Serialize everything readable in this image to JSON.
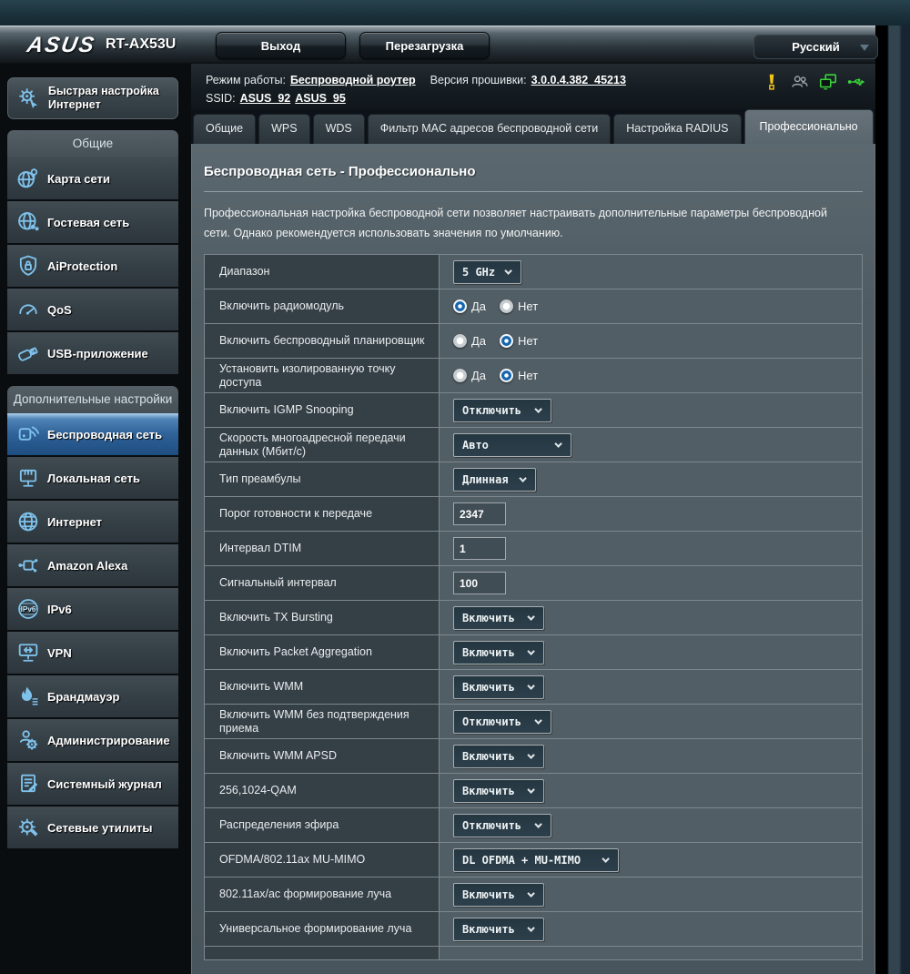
{
  "header": {
    "brand": "ASUS",
    "model": "RT-AX53U",
    "logout_label": "Выход",
    "reboot_label": "Перезагрузка",
    "language": "Русский"
  },
  "infobar": {
    "mode_label": "Режим работы:",
    "mode_value": "Беспроводной роутер",
    "firmware_label": "Версия прошивки:",
    "firmware_value": "3.0.0.4.382_45213",
    "ssid_label": "SSID:",
    "ssids": [
      "ASUS_92",
      "ASUS_95"
    ],
    "status_icons": [
      "warning-icon",
      "clients-icon",
      "devices-icon",
      "usb-icon"
    ]
  },
  "tabs": [
    {
      "label": "Общие",
      "active": false
    },
    {
      "label": "WPS",
      "active": false
    },
    {
      "label": "WDS",
      "active": false
    },
    {
      "label": "Фильтр MAC адресов беспроводной сети",
      "active": false
    },
    {
      "label": "Настройка RADIUS",
      "active": false
    },
    {
      "label": "Профессионально",
      "active": true
    }
  ],
  "page": {
    "title": "Беспроводная сеть - Профессионально",
    "description": "Профессиональная настройка беспроводной сети позволяет настраивать дополнительные параметры беспроводной сети. Однако рекомендуется использовать значения по умолчанию."
  },
  "sidebar": {
    "quick_setup": "Быстрая настройка Интернет",
    "quick_setup_icon": "quick-setup-icon",
    "groups": [
      {
        "header": "Общие",
        "items": [
          {
            "id": "network-map",
            "label": "Карта сети",
            "icon": "network-map-icon",
            "active": false
          },
          {
            "id": "guest-network",
            "label": "Гостевая сеть",
            "icon": "guest-network-icon",
            "active": false
          },
          {
            "id": "aiprotection",
            "label": "AiProtection",
            "icon": "aiprotection-icon",
            "active": false
          },
          {
            "id": "qos",
            "label": "QoS",
            "icon": "qos-icon",
            "active": false
          },
          {
            "id": "usb-app",
            "label": "USB-приложение",
            "icon": "usb-app-icon",
            "active": false
          }
        ]
      },
      {
        "header": "Дополнительные настройки",
        "items": [
          {
            "id": "wireless",
            "label": "Беспроводная сеть",
            "icon": "wireless-icon",
            "active": true
          },
          {
            "id": "lan",
            "label": "Локальная сеть",
            "icon": "lan-icon",
            "active": false
          },
          {
            "id": "wan",
            "label": "Интернет",
            "icon": "internet-icon",
            "active": false
          },
          {
            "id": "alexa",
            "label": "Amazon Alexa",
            "icon": "alexa-icon",
            "active": false
          },
          {
            "id": "ipv6",
            "label": "IPv6",
            "icon": "ipv6-icon",
            "active": false
          },
          {
            "id": "vpn",
            "label": "VPN",
            "icon": "vpn-icon",
            "active": false
          },
          {
            "id": "firewall",
            "label": "Брандмауэр",
            "icon": "firewall-icon",
            "active": false
          },
          {
            "id": "administration",
            "label": "Администрирование",
            "icon": "administration-icon",
            "active": false
          },
          {
            "id": "syslog",
            "label": "Системный журнал",
            "icon": "syslog-icon",
            "active": false
          },
          {
            "id": "network-tools",
            "label": "Сетевые утилиты",
            "icon": "network-tools-icon",
            "active": false
          }
        ]
      }
    ]
  },
  "form": {
    "rows": [
      {
        "label": "Диапазон",
        "type": "select",
        "value": "5 GHz"
      },
      {
        "label": "Включить радиомодуль",
        "type": "radio",
        "options": [
          "Да",
          "Нет"
        ],
        "selected": "Да"
      },
      {
        "label": "Включить беспроводный планировщик",
        "type": "radio",
        "options": [
          "Да",
          "Нет"
        ],
        "selected": "Нет"
      },
      {
        "label": "Установить изолированную точку доступа",
        "type": "radio",
        "options": [
          "Да",
          "Нет"
        ],
        "selected": "Нет"
      },
      {
        "label": "Включить IGMP Snooping",
        "type": "select",
        "value": "Отключить"
      },
      {
        "label": "Скорость многоадресной передачи данных (Мбит/с)",
        "type": "select",
        "value": "Авто",
        "wide": true
      },
      {
        "label": "Тип преамбулы",
        "type": "select",
        "value": "Длинная"
      },
      {
        "label": "Порог готовности к передаче",
        "type": "input",
        "value": "2347"
      },
      {
        "label": "Интервал DTIM",
        "type": "input",
        "value": "1"
      },
      {
        "label": "Сигнальный интервал",
        "type": "input",
        "value": "100"
      },
      {
        "label": "Включить TX Bursting",
        "type": "select",
        "value": "Включить"
      },
      {
        "label": "Включить Packet Aggregation",
        "type": "select",
        "value": "Включить"
      },
      {
        "label": "Включить WMM",
        "type": "select",
        "value": "Включить"
      },
      {
        "label": "Включить WMM без подтверждения приема",
        "type": "select",
        "value": "Отключить"
      },
      {
        "label": "Включить WMM APSD",
        "type": "select",
        "value": "Включить"
      },
      {
        "label": "256,1024-QAM",
        "type": "select",
        "value": "Включить"
      },
      {
        "label": "Распределения эфира",
        "type": "select",
        "value": "Отключить"
      },
      {
        "label": "OFDMA/802.11ax MU-MIMO",
        "type": "select",
        "value": "DL OFDMA + MU-MIMO"
      },
      {
        "label": "802.11ax/ac формирование луча",
        "type": "select",
        "value": "Включить"
      },
      {
        "label": "Универсальное формирование луча",
        "type": "select",
        "value": "Включить"
      },
      {
        "label": "",
        "type": "stub",
        "value": ""
      }
    ]
  },
  "colors": {
    "accent_blue": "#306399",
    "icon_blue": "#7ec2ec",
    "status_green": "#39d439",
    "status_yellow": "#f0c419",
    "panel_bg": "#505c63",
    "label_cell_bg": "#343f46"
  }
}
